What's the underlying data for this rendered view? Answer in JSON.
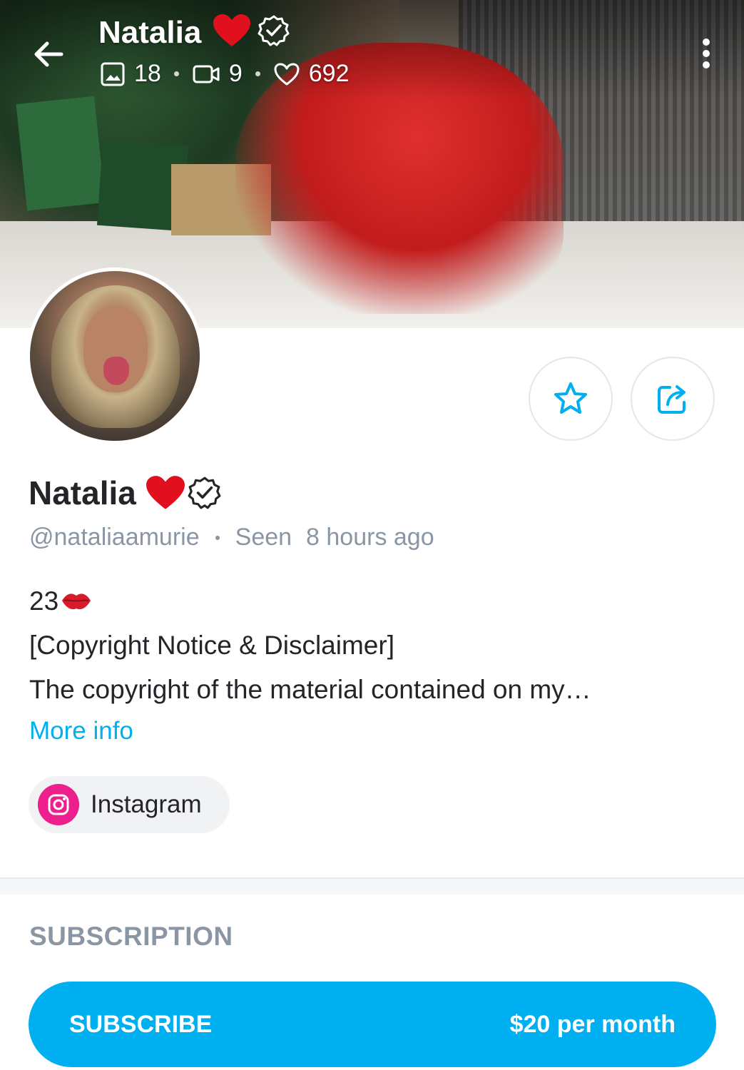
{
  "header": {
    "title": "Natalia",
    "stats": {
      "photos": "18",
      "videos": "9",
      "likes": "692"
    }
  },
  "profile": {
    "name": "Natalia",
    "handle": "@nataliaamurie",
    "seen_label": "Seen",
    "seen_time": "8 hours ago",
    "bio": {
      "age": "23",
      "line1": "[Copyright Notice & Disclaimer]",
      "line2": "The copyright of the material contained on my…"
    },
    "more_info": "More info",
    "social": {
      "label": "Instagram"
    }
  },
  "subscription": {
    "heading": "SUBSCRIPTION",
    "button_label": "SUBSCRIBE",
    "price": "$20 per month"
  },
  "colors": {
    "accent": "#00aff0",
    "muted": "#8a96a3",
    "instagram": "#ec1f8c",
    "heart": "#e0101f"
  },
  "icons": [
    "back-arrow-icon",
    "heart-emoji-icon",
    "verified-badge-icon",
    "image-icon",
    "video-icon",
    "heart-outline-icon",
    "more-vertical-icon",
    "star-icon",
    "share-icon",
    "kiss-lips-icon",
    "instagram-icon"
  ]
}
